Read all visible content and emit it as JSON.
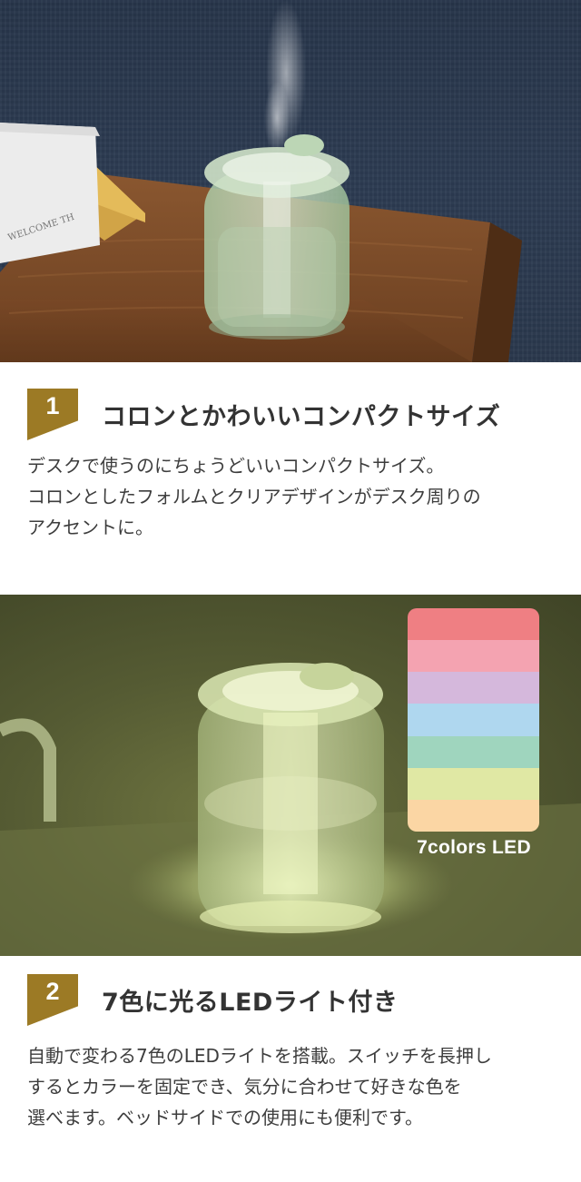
{
  "feature1": {
    "number": "1",
    "title": "コロンとかわいいコンパクトサイズ",
    "body_lines": [
      "デスクで使うのにちょうどいいコンパクトサイズ。",
      "コロンとしたフォルムとクリアデザインがデスク周りの",
      "アクセントに。"
    ]
  },
  "feature2": {
    "number": "2",
    "title": "7色に光るLEDライト付き",
    "body_lines": [
      "自動で変わる7色のLEDライトを搭載。スイッチを長押し",
      "するとカラーを固定でき、気分に合わせて好きな色を",
      "選べます。ベッドサイドでの使用にも便利です。"
    ]
  },
  "led_card": {
    "caption": "7colors LED",
    "colors": [
      "#ef7f83",
      "#f4a3b1",
      "#d5b8dc",
      "#afd7ef",
      "#9fd5be",
      "#e0e8a4",
      "#fbd6a4"
    ]
  },
  "photos": {
    "photo1_label": "WELCOME TH"
  }
}
